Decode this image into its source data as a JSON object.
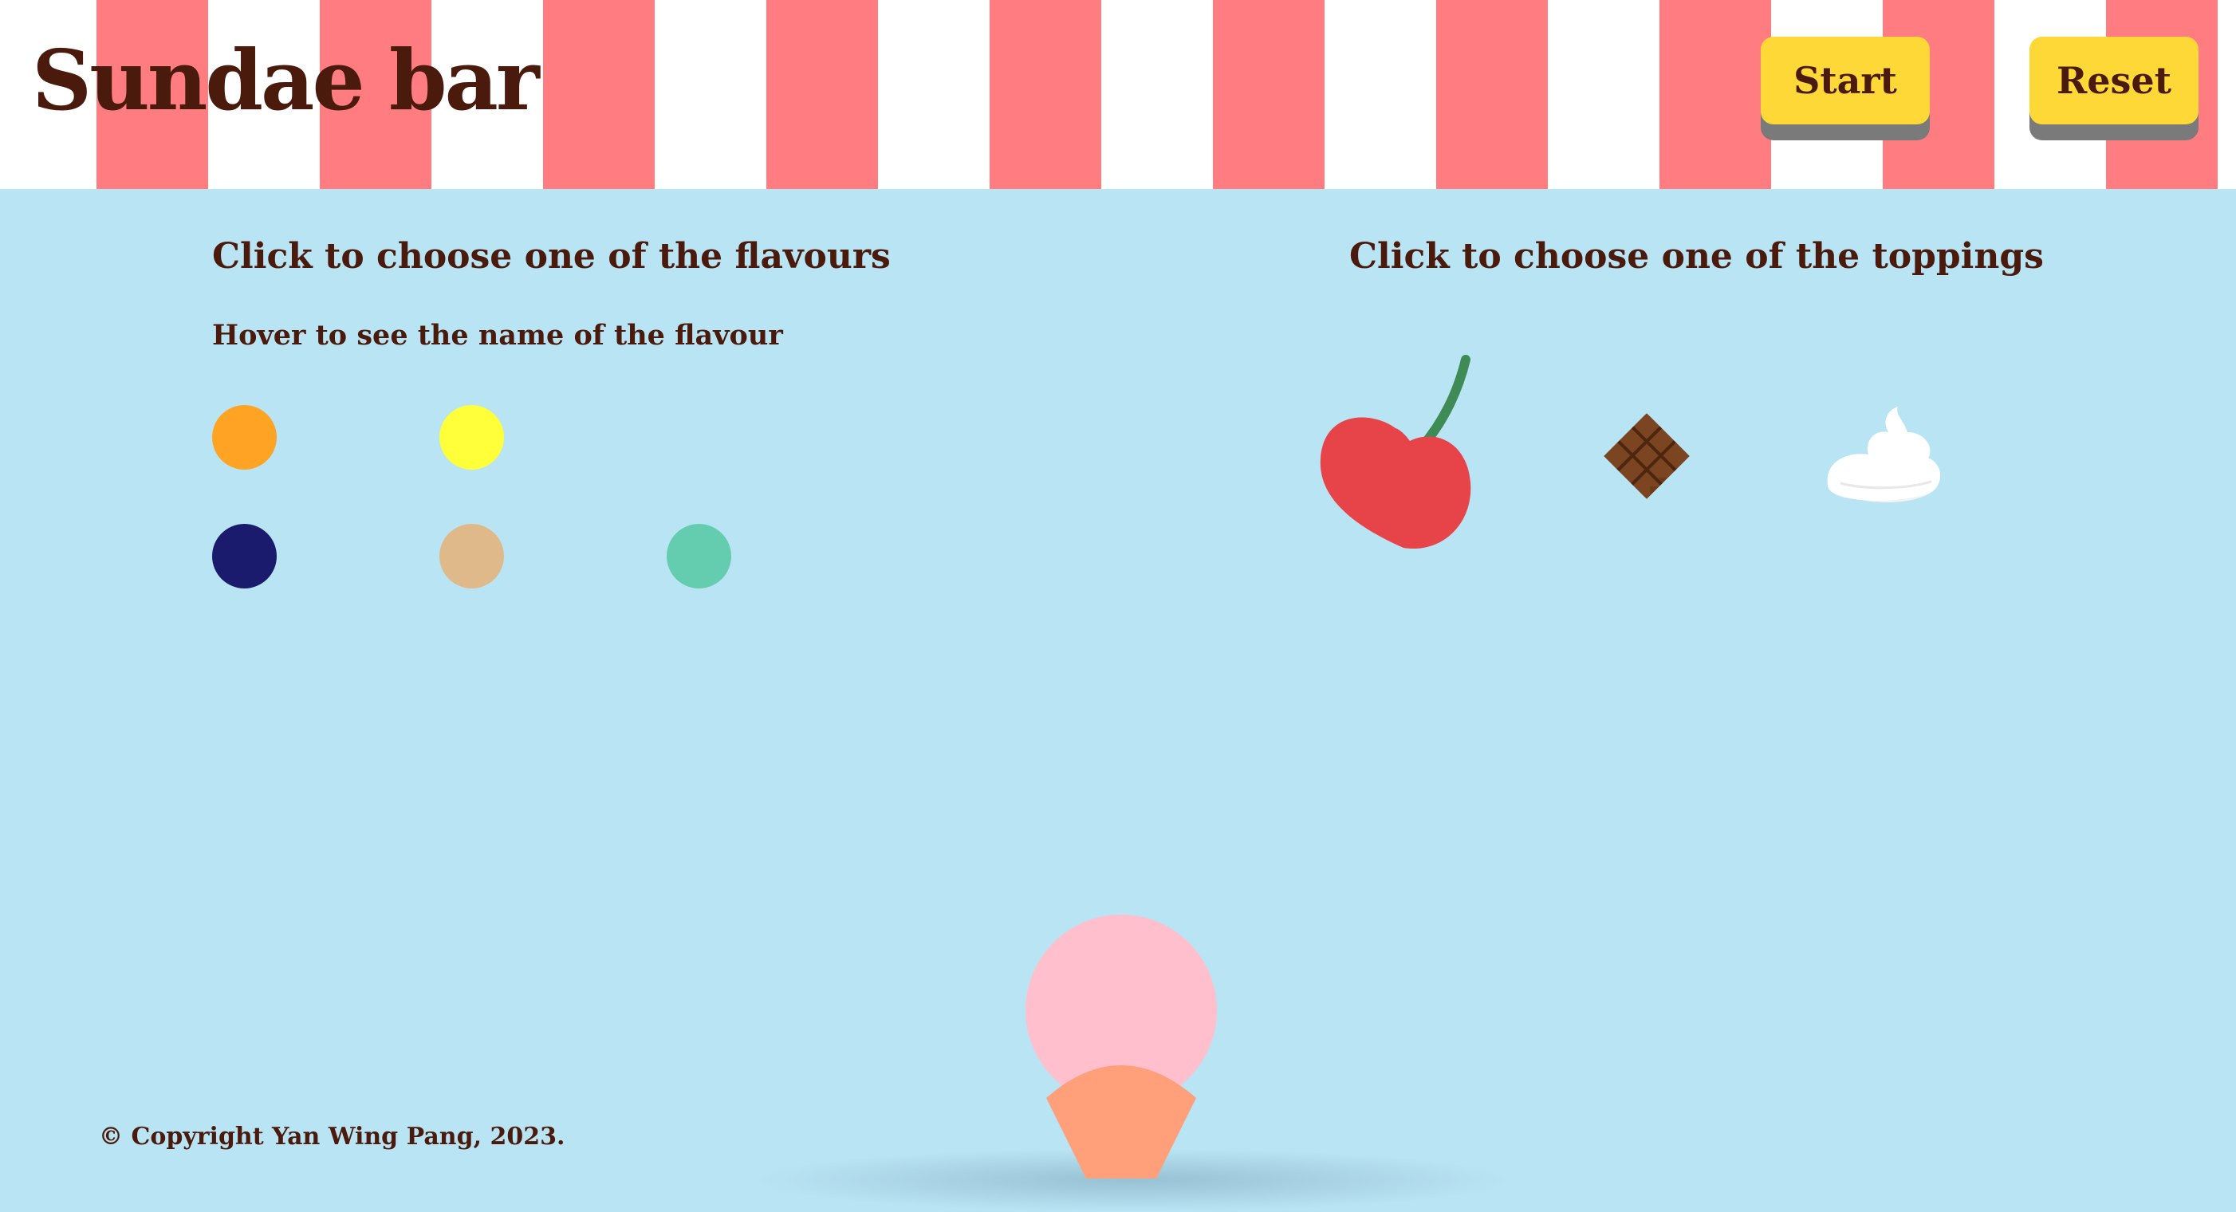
{
  "header": {
    "title": "Sundae bar",
    "start_label": "Start",
    "reset_label": "Reset",
    "stripe_colors": [
      "#ffffff",
      "#ff7d80"
    ]
  },
  "flavours": {
    "heading": "Click to choose one of the flavours",
    "subheading": "Hover to see the name of the flavour",
    "swatches": [
      {
        "color": "#ffa325"
      },
      {
        "color": "#ffff3a"
      },
      {
        "color": "#1b1b6e"
      },
      {
        "color": "#e0b98b"
      },
      {
        "color": "#64cdb0"
      }
    ]
  },
  "toppings": {
    "heading": "Click to choose one of the toppings",
    "items": [
      {
        "icon": "cherry-icon"
      },
      {
        "icon": "chocolate-icon"
      },
      {
        "icon": "whipped-cream-icon"
      }
    ]
  },
  "sundae": {
    "scoop_color": "#ffbfcc",
    "cone_color": "#ffa07a"
  },
  "footer": {
    "copyright": "© Copyright Yan Wing Pang, 2023."
  },
  "colors": {
    "background": "#b9e4f4",
    "text": "#4a1a0c",
    "button": "#fdd836",
    "button_shadow": "#7a7a7a"
  }
}
